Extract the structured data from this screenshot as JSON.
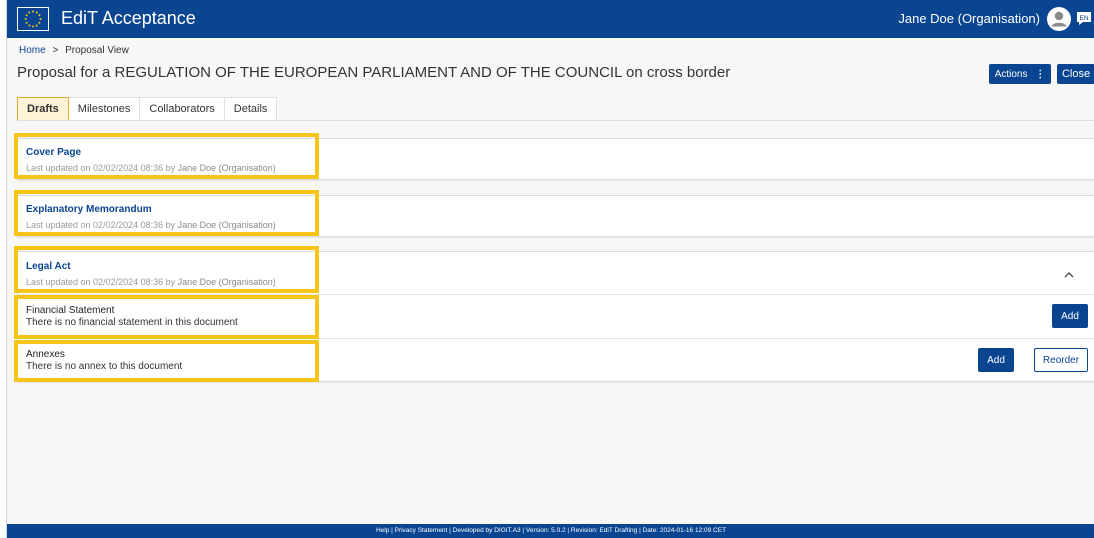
{
  "header": {
    "app_title": "EdiT Acceptance",
    "user_name": "Jane Doe (Organisation)",
    "lang_badge": "EN",
    "brand_color": "#0a4592",
    "icons": {
      "logo": "eu-flag-icon",
      "user": "user-avatar-icon",
      "lang": "language-icon"
    }
  },
  "breadcrumb": {
    "home": "Home",
    "separator": ">",
    "current": "Proposal View"
  },
  "page": {
    "title": "Proposal for a REGULATION OF THE EUROPEAN PARLIAMENT AND OF THE COUNCIL on cross border",
    "actions_label": "Actions",
    "actions_icon": "⋮",
    "close_label": "Close"
  },
  "tabs": [
    {
      "label": "Drafts",
      "active": true
    },
    {
      "label": "Milestones",
      "active": false
    },
    {
      "label": "Collaborators",
      "active": false
    },
    {
      "label": "Details",
      "active": false
    }
  ],
  "drafts": {
    "cover_page": {
      "title": "Cover Page",
      "updated_prefix": "Last updated on 02/02/2024 08:36 by",
      "updated_by": "Jane Doe (Organisation)"
    },
    "explanatory_memorandum": {
      "title": "Explanatory Memorandum",
      "updated_prefix": "Last updated on 02/02/2024 08:36 by",
      "updated_by": "Jane Doe (Organisation)"
    },
    "legal_act": {
      "title": "Legal Act",
      "updated_prefix": "Last updated on 02/02/2024 08:36 by",
      "updated_by": "Jane Doe (Organisation)",
      "expanded": true
    },
    "financial_statement": {
      "title": "Financial Statement",
      "text": "There is no financial statement in this document",
      "add_label": "Add"
    },
    "annexes": {
      "title": "Annexes",
      "text": "There is no annex to this document",
      "add_label": "Add",
      "reorder_label": "Reorder"
    }
  },
  "highlight_color": "#f5c518",
  "footer": {
    "text": "Help | Privacy Statement | Developed by DIGIT.A3 | Version: 5.0.2 | Revision: EdiT Drafting | Date: 2024-01-16 12:09 CET"
  }
}
